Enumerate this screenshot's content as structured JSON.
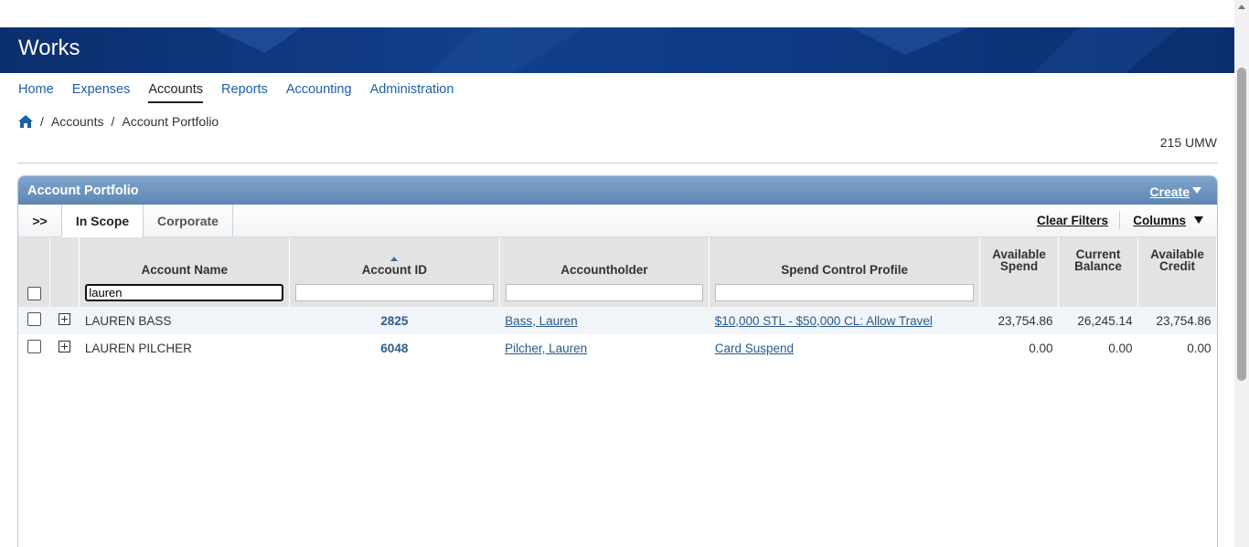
{
  "brand": "Works",
  "nav": [
    {
      "label": "Home",
      "active": false
    },
    {
      "label": "Expenses",
      "active": false
    },
    {
      "label": "Accounts",
      "active": true
    },
    {
      "label": "Reports",
      "active": false
    },
    {
      "label": "Accounting",
      "active": false
    },
    {
      "label": "Administration",
      "active": false
    }
  ],
  "breadcrumb": {
    "sep": "/",
    "items": [
      "Accounts",
      "Account Portfolio"
    ]
  },
  "org": "215 UMW",
  "panel": {
    "title": "Account Portfolio",
    "create_label": "Create",
    "tabs": {
      "expand": ">>",
      "in_scope": "In Scope",
      "corporate": "Corporate"
    },
    "clear_filters": "Clear Filters",
    "columns": "Columns"
  },
  "table": {
    "headers": {
      "account_name": "Account Name",
      "account_id": "Account ID",
      "accountholder": "Accountholder",
      "spend_profile": "Spend Control Profile",
      "available_spend_1": "Available",
      "available_spend_2": "Spend",
      "current_balance_1": "Current",
      "current_balance_2": "Balance",
      "available_credit_1": "Available",
      "available_credit_2": "Credit"
    },
    "filters": {
      "account_name": "lauren",
      "account_id": "",
      "accountholder": "",
      "spend_profile": ""
    },
    "rows": [
      {
        "name": "LAUREN BASS",
        "id": "2825",
        "holder": "Bass, Lauren",
        "profile": "$10,000 STL - $50,000 CL: Allow Travel",
        "avail_spend": "23,754.86",
        "balance": "26,245.14",
        "avail_credit": "23,754.86"
      },
      {
        "name": "LAUREN PILCHER",
        "id": "6048",
        "holder": "Pilcher, Lauren",
        "profile": "Card Suspend",
        "avail_spend": "0.00",
        "balance": "0.00",
        "avail_credit": "0.00"
      }
    ]
  },
  "colors": {
    "banner": "#0b2f6e",
    "link": "#1d5ea8",
    "panel_header": "#6d94bf"
  }
}
